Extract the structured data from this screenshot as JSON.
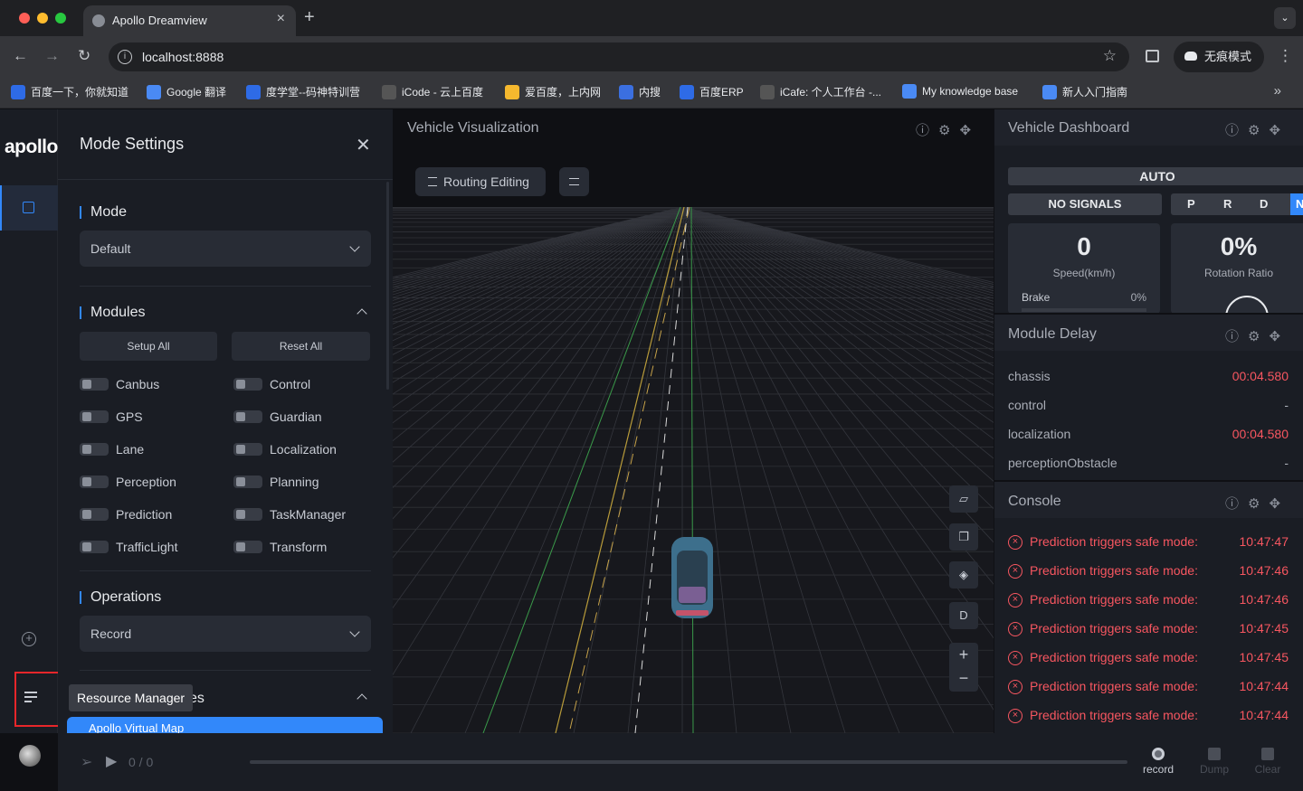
{
  "browser": {
    "tab_title": "Apollo Dreamview",
    "url": "localhost:8888",
    "incognito_label": "无痕模式",
    "bookmarks": [
      {
        "label": "百度一下，你就知道",
        "color": "#2e6be6"
      },
      {
        "label": "Google 翻译",
        "color": "#4a8af4"
      },
      {
        "label": "度学堂--码神特训营",
        "color": "#2e6be6"
      },
      {
        "label": "iCode - 云上百度",
        "color": "#555"
      },
      {
        "label": "爱百度，上内网",
        "color": "#f5b82e"
      },
      {
        "label": "内搜",
        "color": "#3b6fe0"
      },
      {
        "label": "百度ERP",
        "color": "#2e6be6"
      },
      {
        "label": "iCafe: 个人工作台 -...",
        "color": "#555"
      },
      {
        "label": "My knowledge base",
        "color": "#4a8af4"
      },
      {
        "label": "新人入门指南",
        "color": "#4a8af4"
      }
    ]
  },
  "app": {
    "logo": "apollo",
    "tooltip": "Resource Manager"
  },
  "mode_settings": {
    "title": "Mode Settings",
    "mode_label": "Mode",
    "mode_value": "Default",
    "modules_label": "Modules",
    "setup_all": "Setup All",
    "reset_all": "Reset All",
    "modules": [
      "Canbus",
      "Control",
      "GPS",
      "Guardian",
      "Lane",
      "Localization",
      "Perception",
      "Planning",
      "Prediction",
      "TaskManager",
      "TrafficLight",
      "Transform"
    ],
    "operations_label": "Operations",
    "operations_value": "Record",
    "resources_label_partial": "es",
    "resource_item": "Apollo Virtual Map"
  },
  "vehicle_visualization": {
    "title": "Vehicle Visualization",
    "routing_editing": "Routing Editing",
    "view_mode": "D"
  },
  "vehicle_dashboard": {
    "title": "Vehicle Dashboard",
    "driving_mode": "AUTO",
    "signals": "NO SIGNALS",
    "gears": [
      "P",
      "R",
      "D"
    ],
    "active_gear": "N",
    "speed_value": "0",
    "speed_label": "Speed(km/h)",
    "brake_label": "Brake",
    "brake_value": "0%",
    "rotation_value": "0%",
    "rotation_label": "Rotation Ratio"
  },
  "module_delay": {
    "title": "Module Delay",
    "rows": [
      {
        "name": "chassis",
        "value": "00:04.580"
      },
      {
        "name": "control",
        "value": "-"
      },
      {
        "name": "localization",
        "value": "00:04.580"
      },
      {
        "name": "perceptionObstacle",
        "value": "-"
      }
    ]
  },
  "console": {
    "title": "Console",
    "rows": [
      {
        "msg": "Prediction triggers safe mode:",
        "time": "10:47:47"
      },
      {
        "msg": "Prediction triggers safe mode:",
        "time": "10:47:46"
      },
      {
        "msg": "Prediction triggers safe mode:",
        "time": "10:47:46"
      },
      {
        "msg": "Prediction triggers safe mode:",
        "time": "10:47:45"
      },
      {
        "msg": "Prediction triggers safe mode:",
        "time": "10:47:45"
      },
      {
        "msg": "Prediction triggers safe mode:",
        "time": "10:47:44"
      },
      {
        "msg": "Prediction triggers safe mode:",
        "time": "10:47:44"
      }
    ]
  },
  "playback": {
    "progress": "0 / 0",
    "record_label": "record",
    "dump_label": "Dump",
    "clear_label": "Clear"
  }
}
